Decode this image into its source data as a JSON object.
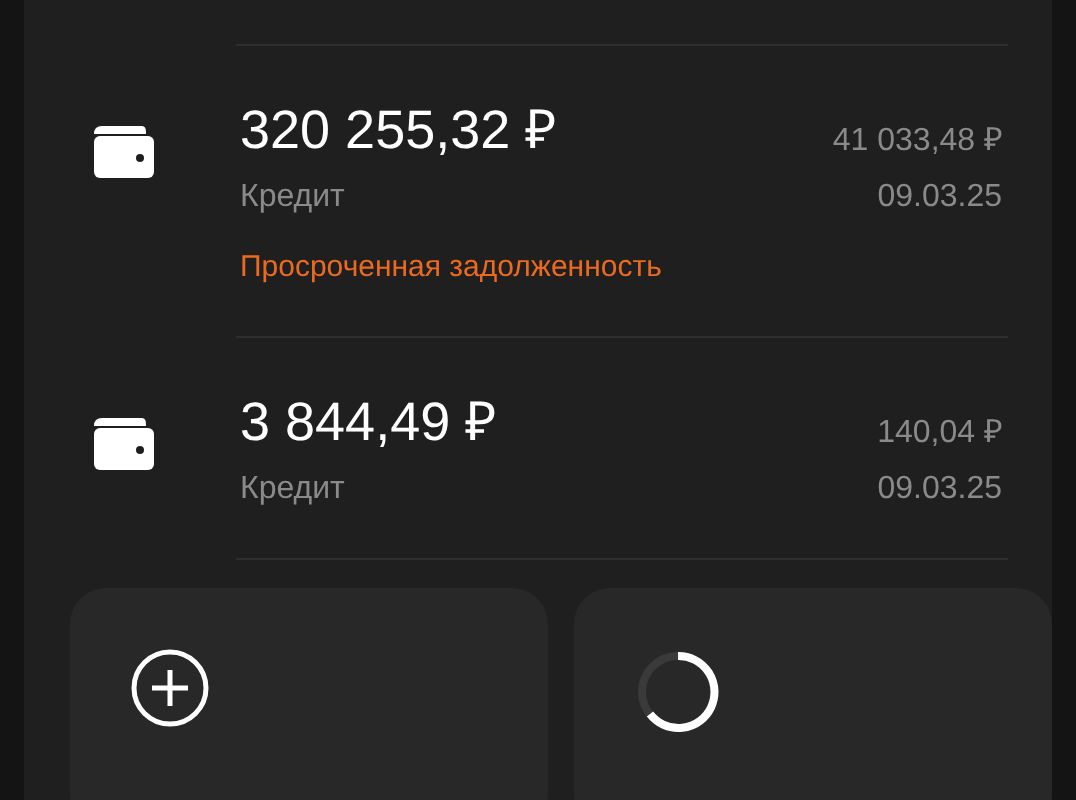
{
  "accounts": [
    {
      "amount": "320 255,32 ₽",
      "type": "Кредит",
      "payment": "41 033,48 ₽",
      "date": "09.03.25",
      "warning": "Просроченная задолженность"
    },
    {
      "amount": "3 844,49 ₽",
      "type": "Кредит",
      "payment": "140,04 ₽",
      "date": "09.03.25"
    }
  ],
  "tiles": [
    {
      "kind": "add"
    },
    {
      "kind": "loading"
    }
  ]
}
